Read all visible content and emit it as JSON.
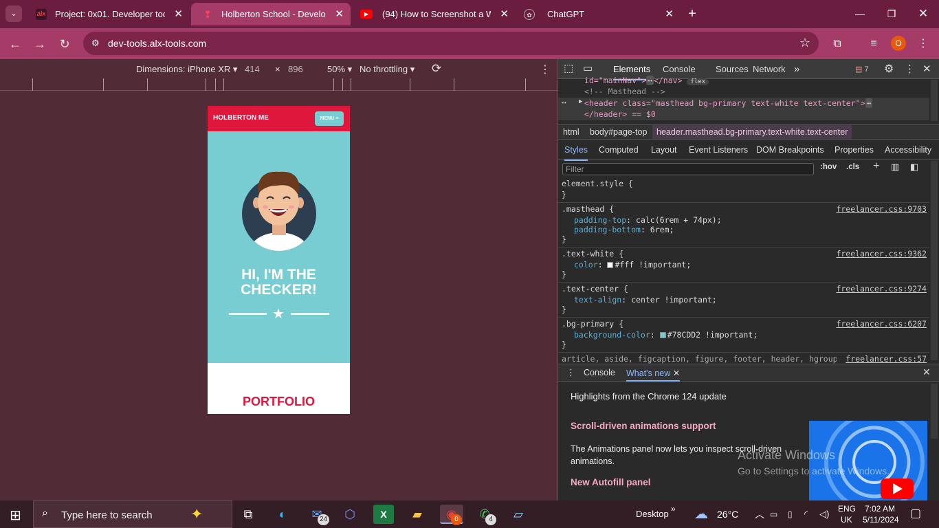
{
  "browser": {
    "tabs": [
      {
        "title": "Project: 0x01. Developer tools |",
        "favicon": "alx-icon",
        "active": false
      },
      {
        "title": "Holberton School - Developer t",
        "favicon": "holberton-icon",
        "active": true
      },
      {
        "title": "(94) How to Screenshot a Web I",
        "favicon": "youtube-icon",
        "active": false
      },
      {
        "title": "ChatGPT",
        "favicon": "chatgpt-icon",
        "active": false
      }
    ],
    "url": "dev-tools.alx-tools.com",
    "profile_initial": "O"
  },
  "device_toolbar": {
    "dimensions_label": "Dimensions: iPhone XR",
    "width": "414",
    "times": "×",
    "height": "896",
    "zoom": "50%",
    "throttling": "No throttling"
  },
  "page": {
    "brand": "HOLBERTON ME",
    "menu": "MENU ≡",
    "headline_line1": "HI, I'M THE",
    "headline_line2": "CHECKER!",
    "section": "PORTFOLIO",
    "colors": {
      "primary": "#e0173d",
      "masthead": "#78cdd2"
    }
  },
  "devtools": {
    "tabs": [
      "Elements",
      "Console",
      "Sources",
      "Network"
    ],
    "issues_count": "7",
    "dom": {
      "line1": "id=\"mainNav\">",
      "line1_end": "</nav>",
      "line1_badge": "flex",
      "line2": "<!-- Masthead -->",
      "line3": "<header class=\"masthead bg-primary text-white text-center\">",
      "line4": "</header> == $0"
    },
    "breadcrumbs": [
      "html",
      "body#page-top",
      "header.masthead.bg-primary.text-white.text-center"
    ],
    "subtabs": [
      "Styles",
      "Computed",
      "Layout",
      "Event Listeners",
      "DOM Breakpoints",
      "Properties",
      "Accessibility"
    ],
    "filter_placeholder": "Filter",
    "hov": ":hov",
    "cls": ".cls",
    "rules": {
      "element_style": "element.style {",
      "close": "}",
      "masthead_sel": ".masthead {",
      "masthead_src": "freelancer.css:9703",
      "masthead_p1": "padding-top",
      "masthead_v1": "calc(6rem + 74px);",
      "masthead_p2": "padding-bottom",
      "masthead_v2": "6rem;",
      "white_sel": ".text-white {",
      "white_src": "freelancer.css:9362",
      "white_p": "color",
      "white_v": "#fff !important;",
      "center_sel": ".text-center {",
      "center_src": "freelancer.css:9274",
      "center_p": "text-align",
      "center_v": "center !important;",
      "bg_sel": ".bg-primary {",
      "bg_src": "freelancer.css:6207",
      "bg_p": "background-color",
      "bg_v": "#78CDD2 !important;",
      "last_sel": "article, aside, figcaption, figure, footer, header, hgroup,",
      "last_src": "freelancer.css:57"
    },
    "drawer": {
      "tab_console": "Console",
      "tab_whatsnew": "What's new",
      "highlights": "Highlights from the Chrome 124 update",
      "h1": "Scroll-driven animations support",
      "p1": "The Animations panel now lets you inspect scroll-driven animations.",
      "h2": "New Autofill panel"
    }
  },
  "watermark": {
    "line1": "Activate Windows",
    "line2": "Go to Settings to activate Windows."
  },
  "taskbar": {
    "search_placeholder": "Type here to search",
    "mail_badge": "24",
    "chrome_badge": "0",
    "whatsapp_badge": "4",
    "desktop_label": "Desktop",
    "temperature": "26°C",
    "lang1": "ENG",
    "lang2": "UK",
    "time": "7:02 AM",
    "date": "5/11/2024"
  }
}
